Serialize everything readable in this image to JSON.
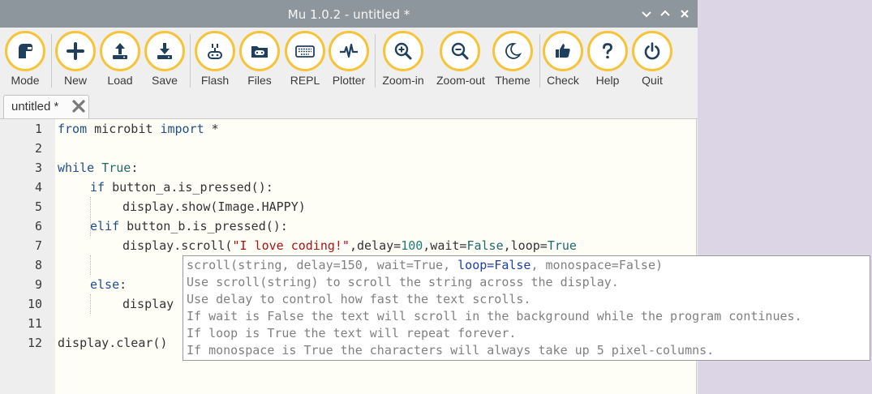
{
  "window": {
    "title": "Mu 1.0.2 - untitled *"
  },
  "toolbar": {
    "buttons": [
      {
        "label": "Mode",
        "icon": "mode-icon"
      },
      {
        "label": "New",
        "icon": "plus-icon"
      },
      {
        "label": "Load",
        "icon": "upload-icon"
      },
      {
        "label": "Save",
        "icon": "download-icon"
      },
      {
        "label": "Flash",
        "icon": "flash-icon"
      },
      {
        "label": "Files",
        "icon": "files-icon"
      },
      {
        "label": "REPL",
        "icon": "keyboard-icon"
      },
      {
        "label": "Plotter",
        "icon": "pulse-icon"
      },
      {
        "label": "Zoom-in",
        "icon": "zoom-in-icon"
      },
      {
        "label": "Zoom-out",
        "icon": "zoom-out-icon"
      },
      {
        "label": "Theme",
        "icon": "moon-icon"
      },
      {
        "label": "Check",
        "icon": "thumbs-up-icon"
      },
      {
        "label": "Help",
        "icon": "question-icon"
      },
      {
        "label": "Quit",
        "icon": "power-icon"
      }
    ],
    "accent_color": "#f6c43a"
  },
  "tab": {
    "label": "untitled *"
  },
  "editor": {
    "line_numbers": [
      "1",
      "2",
      "3",
      "4",
      "5",
      "6",
      "7",
      "8",
      "9",
      "10",
      "11",
      "12"
    ],
    "lines": {
      "l1": {
        "kw1": "from",
        "mod": " microbit ",
        "kw2": "import",
        "rest": " *"
      },
      "l3": {
        "kw": "while",
        "sp": " ",
        "val": "True",
        "rest": ":"
      },
      "l4": {
        "kw": "if",
        "rest": " button_a.is_pressed():"
      },
      "l5": {
        "code": "display.show(Image.HAPPY)"
      },
      "l6": {
        "kw": "elif",
        "rest": " button_b.is_pressed():"
      },
      "l7": {
        "a": "display.scroll(",
        "str": "\"I love coding!\"",
        "b": ",delay=",
        "num": "100",
        "c": ",wait=",
        "v1": "False",
        "d": ",loop=",
        "v2": "True"
      },
      "l9": {
        "kw": "else",
        "rest": ":"
      },
      "l10": {
        "code": "display"
      },
      "l12": {
        "code": "display.clear()"
      }
    }
  },
  "calltip": {
    "sig_a": "scroll(string, delay=150, wait=True, ",
    "sig_hl": "loop=False",
    "sig_b": ", monospace=False)",
    "line2": "Use scroll(string) to scroll the string across the display.",
    "line3": "Use delay to control how fast the text scrolls.",
    "line4": "If wait is False the text will scroll in the background while the program continues.",
    "line5": "If loop is True the text will repeat forever.",
    "line6": "If monospace is True the characters will always take up 5 pixel-columns."
  }
}
